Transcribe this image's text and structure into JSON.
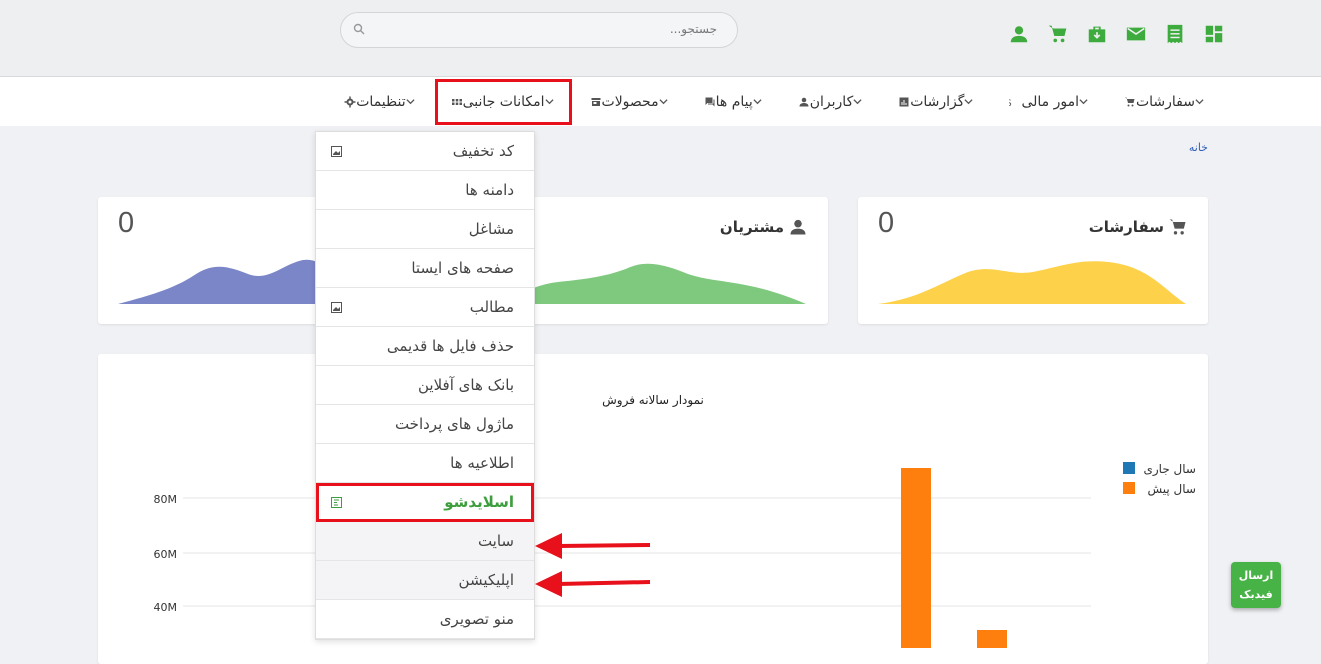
{
  "topbar": {
    "search_placeholder": "جستجو...",
    "icons": [
      "dashboard-icon",
      "receipt-icon",
      "mail-icon",
      "briefcase-icon",
      "cart-icon",
      "user-icon"
    ]
  },
  "nav": {
    "items": [
      {
        "label": "سفارشات",
        "icon": "cart-icon"
      },
      {
        "label": "امور مالی",
        "icon": "dollar-icon"
      },
      {
        "label": "گزارشات",
        "icon": "report-icon"
      },
      {
        "label": "کاربران",
        "icon": "user-icon"
      },
      {
        "label": "پیام ها",
        "icon": "chat-icon"
      },
      {
        "label": "محصولات",
        "icon": "store-icon"
      },
      {
        "label": "امکانات جانبی",
        "icon": "grid-icon"
      },
      {
        "label": "تنظیمات",
        "icon": "gear-icon"
      }
    ]
  },
  "breadcrumb": "خانه",
  "cards": [
    {
      "title": "سفارشات",
      "value": "0",
      "color": "#fdd14a"
    },
    {
      "title": "مشتریان",
      "value": "0",
      "color": "#7fc97f"
    },
    {
      "title": "",
      "value": "0",
      "color": "#7b86c8"
    }
  ],
  "dropdown": {
    "items": [
      {
        "label": "کد تخفیف",
        "icon": "image-icon"
      },
      {
        "label": "دامنه ها",
        "icon": ""
      },
      {
        "label": "مشاغل",
        "icon": ""
      },
      {
        "label": "صفحه های ایستا",
        "icon": ""
      },
      {
        "label": "مطالب",
        "icon": "image-icon"
      },
      {
        "label": "حذف فایل ها قدیمی",
        "icon": ""
      },
      {
        "label": "بانک های آفلاین",
        "icon": ""
      },
      {
        "label": "ماژول های پرداخت",
        "icon": ""
      },
      {
        "label": "اطلاعیه ها",
        "icon": ""
      },
      {
        "label": "اسلایدشو",
        "icon": "slideshow-icon",
        "active": true
      },
      {
        "label": "سایت",
        "icon": "",
        "sub": true
      },
      {
        "label": "اپلیکیشن",
        "icon": "",
        "sub": true
      },
      {
        "label": "منو تصویری",
        "icon": ""
      }
    ]
  },
  "feedback": {
    "line1": "ارسال",
    "line2": "فیدبک"
  },
  "chart_data": {
    "type": "bar",
    "title": "نمودار سالانه فروش",
    "series": [
      {
        "name": "سال جاری",
        "color": "#1f77b4"
      },
      {
        "name": "سال پیش",
        "color": "#ff7f0e"
      }
    ],
    "yticks": [
      "80M",
      "60M",
      "40M"
    ],
    "bars": [
      {
        "series": "سال پیش",
        "value": 92
      },
      {
        "series": "سال پیش",
        "value": 31
      }
    ]
  }
}
